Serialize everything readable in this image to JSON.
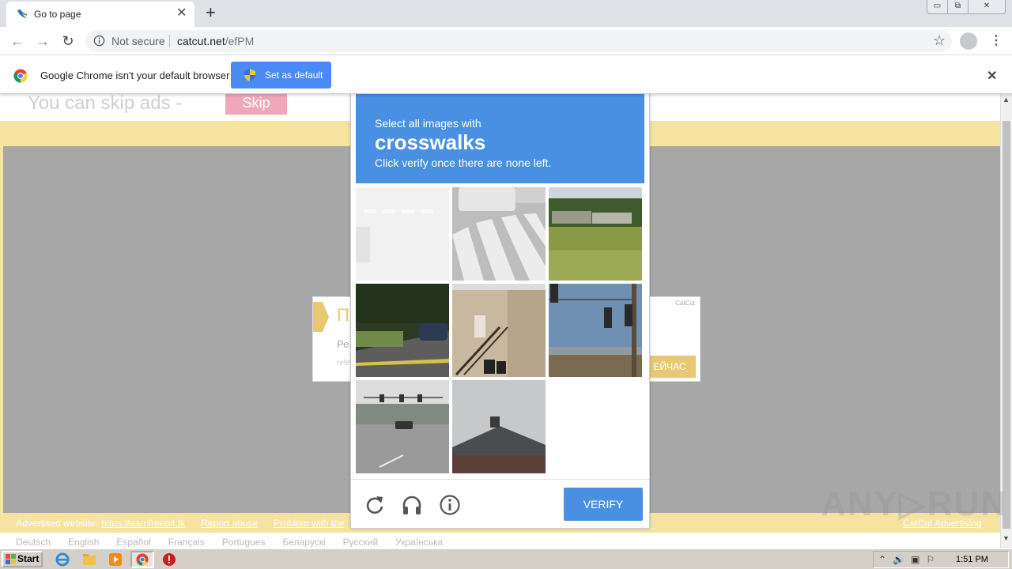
{
  "browser": {
    "tab_title": "Go to page",
    "tab_close": "✕",
    "new_tab": "+",
    "window_buttons": [
      "▭",
      "⧉",
      "✕"
    ],
    "security_label": "Not secure",
    "url_host": "catcut.net",
    "url_path": "/efPM",
    "nav": {
      "back": "←",
      "forward": "→",
      "reload": "↻"
    },
    "star": "☆",
    "menu": "⋮"
  },
  "infobar": {
    "message": "Google Chrome isn't your default browser",
    "button_label": "Set as default",
    "close": "✕"
  },
  "page": {
    "skip_text": "You can skip ads -",
    "skip_button": "Skip",
    "ad": {
      "title": "П",
      "line1": "Ре",
      "line2": "refe",
      "brand": "CatCut",
      "button": "ЕЙЧАС"
    },
    "footer_links": [
      "Advertised website:",
      "https://earnfreebit.tk",
      "Report abuse",
      "Problem with the"
    ],
    "footer_right": "CatCut Advertising",
    "languages": [
      "Deutsch",
      "English",
      "Español",
      "Français",
      "Portugues",
      "Беларускі",
      "Русский",
      "Українська"
    ]
  },
  "captcha": {
    "instruction_line1": "Select all images with",
    "target": "crosswalks",
    "instruction_line3": "Click verify once there are none left.",
    "verify_label": "VERIFY",
    "tiles": [
      "tile-faded-crosswalk",
      "tile-crosswalk-truck",
      "tile-boats-field",
      "tile-car-road",
      "tile-building-stairs",
      "tile-traffic-lights",
      "tile-intersection",
      "tile-roof",
      "tile-empty"
    ],
    "footer_icons": [
      "reload-icon",
      "audio-icon",
      "info-icon"
    ]
  },
  "watermark": "ANY▷RUN",
  "taskbar": {
    "start_label": "Start",
    "clock": "1:51 PM",
    "tray": [
      "⌃",
      "🔊",
      "▣",
      "⚐"
    ]
  },
  "colors": {
    "captcha_blue": "#4a90e2",
    "chrome_blue": "#4a8af4",
    "ad_yellow": "#f6e3a0",
    "skip_pink": "#f0a7b8"
  }
}
